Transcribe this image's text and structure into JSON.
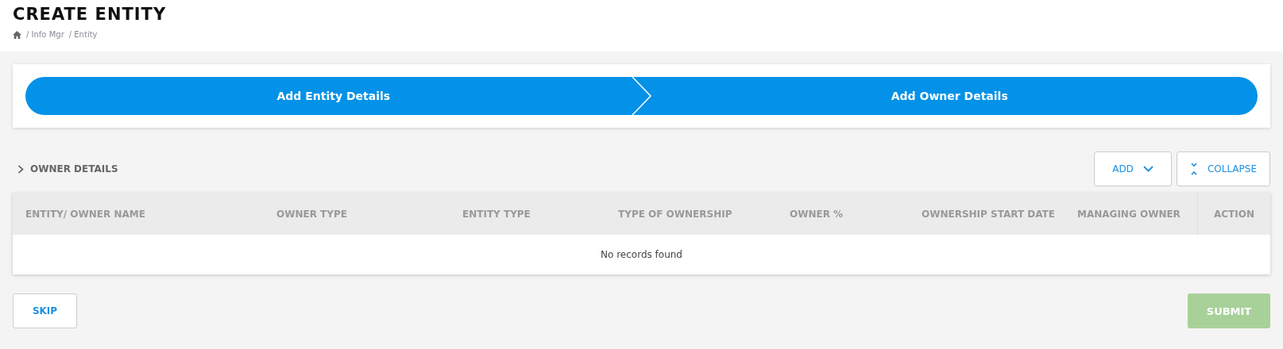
{
  "page_title": "CREATE ENTITY",
  "breadcrumb": [
    "/ Info Mgr",
    "/ Entity"
  ],
  "steps": [
    {
      "label": "Add Entity Details",
      "active": true
    },
    {
      "label": "Add Owner Details",
      "active": true
    }
  ],
  "section": {
    "title": "OWNER DETAILS",
    "expanded": false,
    "add_button": "ADD",
    "collapse_button": "COLLAPSE"
  },
  "table": {
    "columns": [
      "ENTITY/ OWNER NAME",
      "OWNER TYPE",
      "ENTITY TYPE",
      "TYPE OF OWNERSHIP",
      "OWNER %",
      "OWNERSHIP START DATE",
      "MANAGING OWNER",
      "ACTION"
    ],
    "empty_message": "No records found"
  },
  "buttons": {
    "skip": "SKIP",
    "submit": {
      "label": "SUBMIT",
      "disabled": true
    }
  }
}
